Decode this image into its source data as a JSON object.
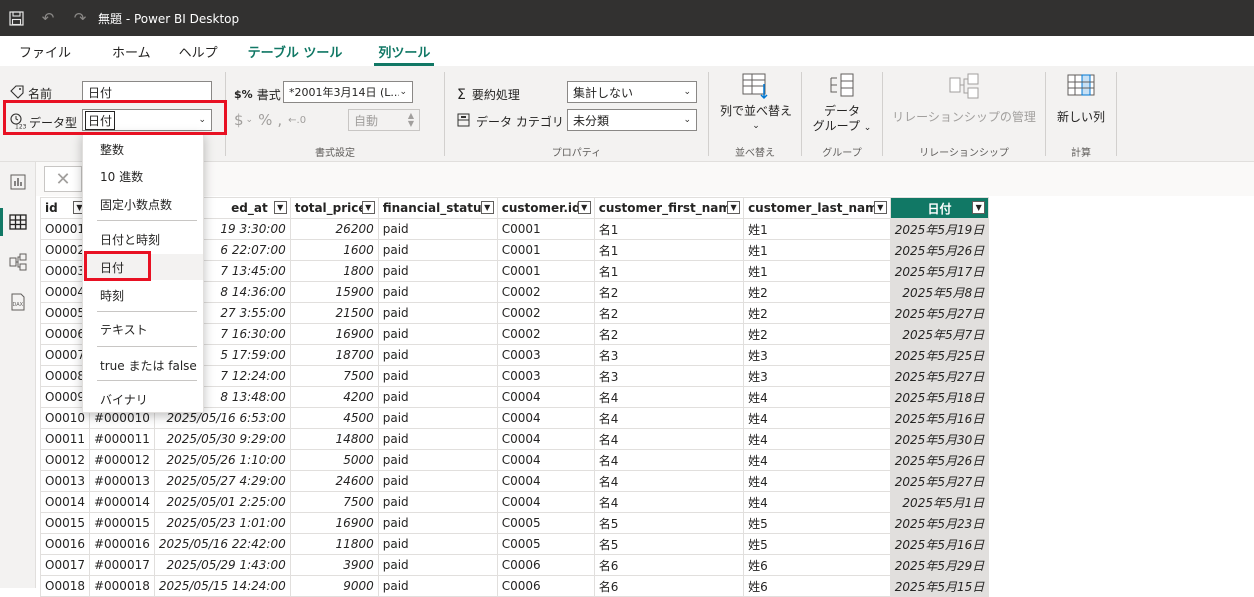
{
  "titlebar": {
    "title": "無題 - Power BI Desktop"
  },
  "tabs": [
    {
      "label": "ファイル"
    },
    {
      "label": "ホーム"
    },
    {
      "label": "ヘルプ"
    },
    {
      "label": "テーブル ツール"
    },
    {
      "label": "列ツール"
    }
  ],
  "ribbon": {
    "structure": {
      "name_label": "名前",
      "name_value": "日付",
      "datatype_label": "データ型",
      "datatype_value": "日付"
    },
    "format": {
      "format_label": "書式",
      "format_value": "*2001年3月14日 (L...",
      "percent_symbol": "%",
      "auto_value": "自動",
      "group_label": "書式設定"
    },
    "properties": {
      "summarize_label": "要約処理",
      "summarize_value": "集計しない",
      "category_label": "データ カテゴリ",
      "category_value": "未分類",
      "group_label": "プロパティ"
    },
    "sort": {
      "button_label": "列で並べ替え",
      "group_label": "並べ替え"
    },
    "groups": {
      "button_label": "データ\nグループ",
      "group_label": "グループ"
    },
    "relationships": {
      "button_label": "リレーションシップの管理",
      "group_label": "リレーションシップ"
    },
    "calculations": {
      "button_label": "新しい列",
      "group_label": "計算"
    }
  },
  "dropdown": {
    "items": [
      "整数",
      "10 進数",
      "固定小数点数",
      "日付と時刻",
      "日付",
      "時刻",
      "テキスト",
      "true または false",
      "バイナリ"
    ]
  },
  "table": {
    "columns": [
      "id",
      "ed_at",
      "total_price",
      "financial_status",
      "customer.id",
      "customer_first_name",
      "customer_last_name",
      "日付"
    ],
    "rows": [
      [
        "O0001",
        "",
        "19 3:30:00",
        "26200",
        "paid",
        "C0001",
        "名1",
        "姓1",
        "2025年5月19日"
      ],
      [
        "O0002",
        "",
        "6 22:07:00",
        "1600",
        "paid",
        "C0001",
        "名1",
        "姓1",
        "2025年5月26日"
      ],
      [
        "O0003",
        "",
        "7 13:45:00",
        "1800",
        "paid",
        "C0001",
        "名1",
        "姓1",
        "2025年5月17日"
      ],
      [
        "O0004",
        "",
        "8 14:36:00",
        "15900",
        "paid",
        "C0002",
        "名2",
        "姓2",
        "2025年5月8日"
      ],
      [
        "O0005",
        "",
        "27 3:55:00",
        "21500",
        "paid",
        "C0002",
        "名2",
        "姓2",
        "2025年5月27日"
      ],
      [
        "O0006",
        "",
        "7 16:30:00",
        "16900",
        "paid",
        "C0002",
        "名2",
        "姓2",
        "2025年5月7日"
      ],
      [
        "O0007",
        "",
        "5 17:59:00",
        "18700",
        "paid",
        "C0003",
        "名3",
        "姓3",
        "2025年5月25日"
      ],
      [
        "O0008",
        "",
        "7 12:24:00",
        "7500",
        "paid",
        "C0003",
        "名3",
        "姓3",
        "2025年5月27日"
      ],
      [
        "O0009",
        "",
        "8 13:48:00",
        "4200",
        "paid",
        "C0004",
        "名4",
        "姓4",
        "2025年5月18日"
      ],
      [
        "O0010",
        "#000010",
        "2025/05/16 6:53:00",
        "4500",
        "paid",
        "C0004",
        "名4",
        "姓4",
        "2025年5月16日"
      ],
      [
        "O0011",
        "#000011",
        "2025/05/30 9:29:00",
        "14800",
        "paid",
        "C0004",
        "名4",
        "姓4",
        "2025年5月30日"
      ],
      [
        "O0012",
        "#000012",
        "2025/05/26 1:10:00",
        "5000",
        "paid",
        "C0004",
        "名4",
        "姓4",
        "2025年5月26日"
      ],
      [
        "O0013",
        "#000013",
        "2025/05/27 4:29:00",
        "24600",
        "paid",
        "C0004",
        "名4",
        "姓4",
        "2025年5月27日"
      ],
      [
        "O0014",
        "#000014",
        "2025/05/01 2:25:00",
        "7500",
        "paid",
        "C0004",
        "名4",
        "姓4",
        "2025年5月1日"
      ],
      [
        "O0015",
        "#000015",
        "2025/05/23 1:01:00",
        "16900",
        "paid",
        "C0005",
        "名5",
        "姓5",
        "2025年5月23日"
      ],
      [
        "O0016",
        "#000016",
        "2025/05/16 22:42:00",
        "11800",
        "paid",
        "C0005",
        "名5",
        "姓5",
        "2025年5月16日"
      ],
      [
        "O0017",
        "#000017",
        "2025/05/29 1:43:00",
        "3900",
        "paid",
        "C0006",
        "名6",
        "姓6",
        "2025年5月29日"
      ],
      [
        "O0018",
        "#000018",
        "2025/05/15 14:24:00",
        "9000",
        "paid",
        "C0006",
        "名6",
        "姓6",
        "2025年5月15日"
      ]
    ]
  },
  "colors": {
    "accent": "#117865",
    "highlight": "#e81123",
    "titlebar": "#323130"
  }
}
